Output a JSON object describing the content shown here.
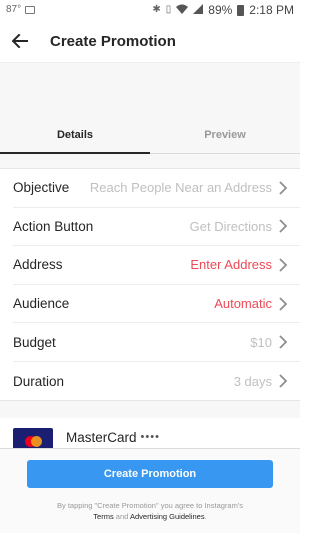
{
  "status_bar": {
    "temperature": "87°",
    "battery": "89%",
    "time": "2:18 PM"
  },
  "header": {
    "title": "Create Promotion"
  },
  "tabs": [
    {
      "label": "Details",
      "active": true
    },
    {
      "label": "Preview",
      "active": false
    }
  ],
  "settings": [
    {
      "label": "Objective",
      "value": "Reach People Near an Address",
      "value_style": "muted"
    },
    {
      "label": "Action Button",
      "value": "Get Directions",
      "value_style": "muted"
    },
    {
      "label": "Address",
      "value": "Enter Address",
      "value_style": "red"
    },
    {
      "label": "Audience",
      "value": "Automatic",
      "value_style": "red"
    },
    {
      "label": "Budget",
      "value": "$10",
      "value_style": "muted"
    },
    {
      "label": "Duration",
      "value": "3 days",
      "value_style": "muted"
    }
  ],
  "payment": {
    "card_name": "MasterCard",
    "card_digits": "••••"
  },
  "footer": {
    "cta_label": "Create Promotion",
    "legal_prefix": "By tapping \"Create Promotion\" you agree to Instagram's",
    "terms_label": "Terms",
    "and_text": "and",
    "guidelines_label": "Advertising Guidelines",
    "period": "."
  },
  "colors": {
    "accent": "#3897f0",
    "warning_red": "#ed4956",
    "muted_text": "#c0c0c0"
  }
}
